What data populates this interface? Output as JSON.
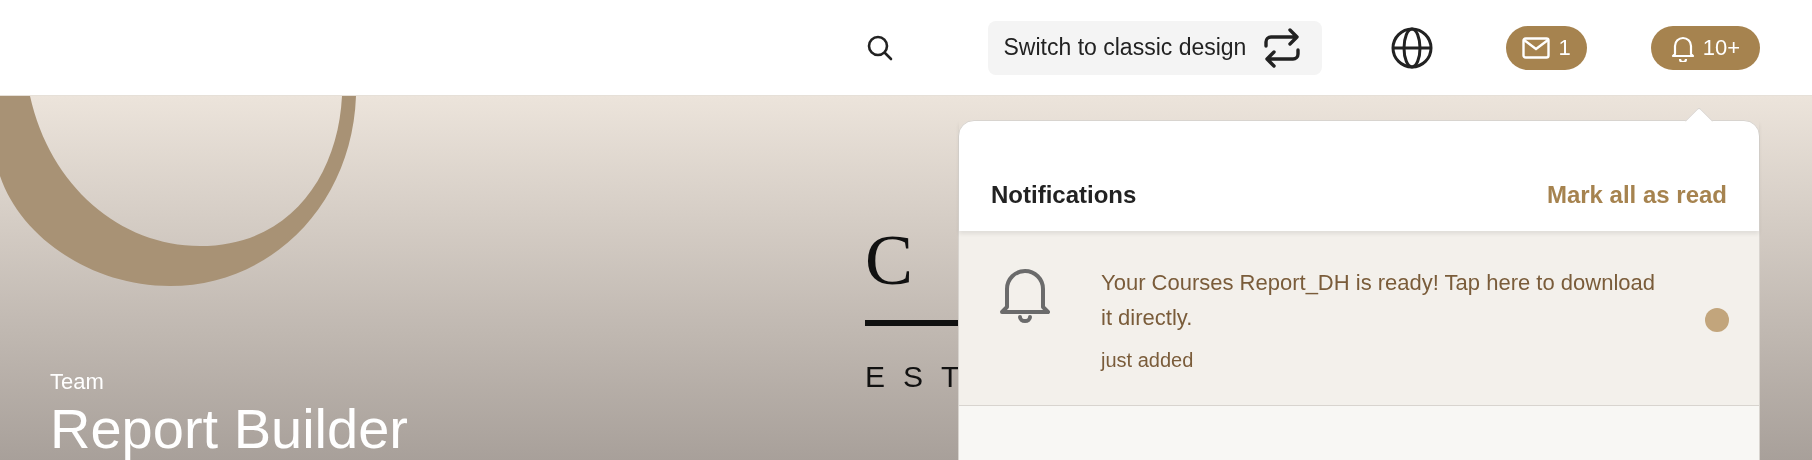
{
  "topbar": {
    "switch_button": "Switch to classic design",
    "messages_badge": "1",
    "notifications_badge": "10+"
  },
  "banner": {
    "eyebrow": "Team",
    "title": "Report Builder",
    "logo": {
      "wordmark": "C",
      "tagline": "EST"
    }
  },
  "notifications": {
    "title": "Notifications",
    "mark_all": "Mark all as read",
    "open": true,
    "items": [
      {
        "text": "Your Courses Report_DH is ready! Tap here to download it directly.",
        "time": "just added",
        "unread": true
      }
    ]
  }
}
